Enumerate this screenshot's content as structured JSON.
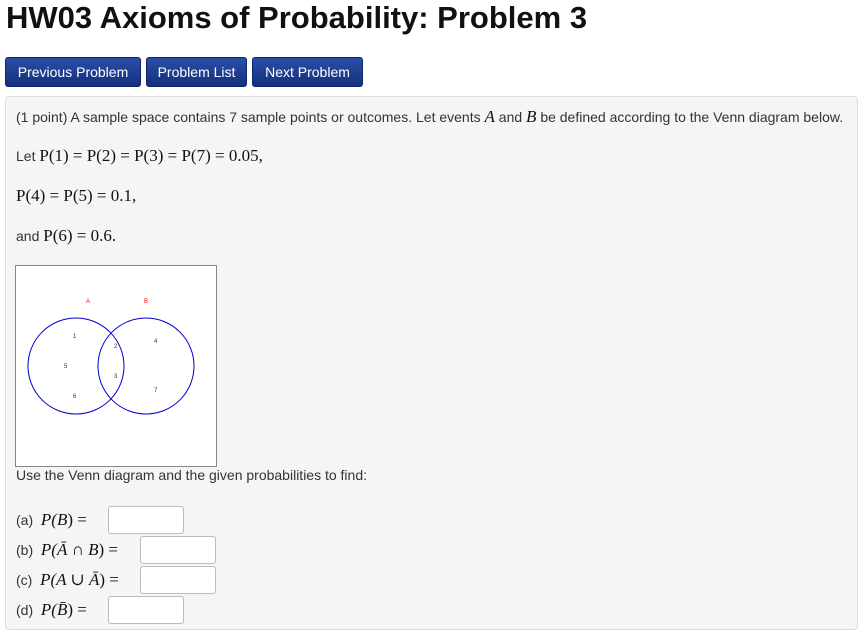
{
  "title": "HW03 Axioms of Probability: Problem 3",
  "nav": {
    "previous": "Previous Problem",
    "list": "Problem List",
    "next": "Next Problem"
  },
  "problem": {
    "intro_points": "(1 point)",
    "intro_text1": "A sample space contains 7 sample points or outcomes. Let events",
    "A": "A",
    "and": "and",
    "B": "B",
    "intro_text2": "be defined according to the Venn diagram below.",
    "let_word": "Let",
    "probs_line1": "P(1) = P(2) = P(3) = P(7) = 0.05,",
    "probs_line2": "P(4) = P(5) = 0.1,",
    "and_word": "and",
    "probs_line3": "P(6) = 0.6.",
    "instruction": "Use the Venn diagram and the given probabilities to find:"
  },
  "venn": {
    "label_A": "A",
    "label_B": "B",
    "points": [
      "1",
      "2",
      "3",
      "4",
      "5",
      "6",
      "7"
    ],
    "circle_color": "#0000cc",
    "label_color": "#ff0000"
  },
  "parts": [
    {
      "label": "(a)",
      "expr_pre": "P(",
      "expr_mid": "B",
      "expr_post": ") =",
      "value": ""
    },
    {
      "label": "(b)",
      "expr_pre": "P(",
      "expr_mid": "Ā ∩ B",
      "expr_post": ") =",
      "value": ""
    },
    {
      "label": "(c)",
      "expr_pre": "P(",
      "expr_mid": "A ∪ Ā",
      "expr_post": ") =",
      "value": ""
    },
    {
      "label": "(d)",
      "expr_pre": "P(",
      "expr_mid": "B̄",
      "expr_post": ") =",
      "value": ""
    }
  ]
}
